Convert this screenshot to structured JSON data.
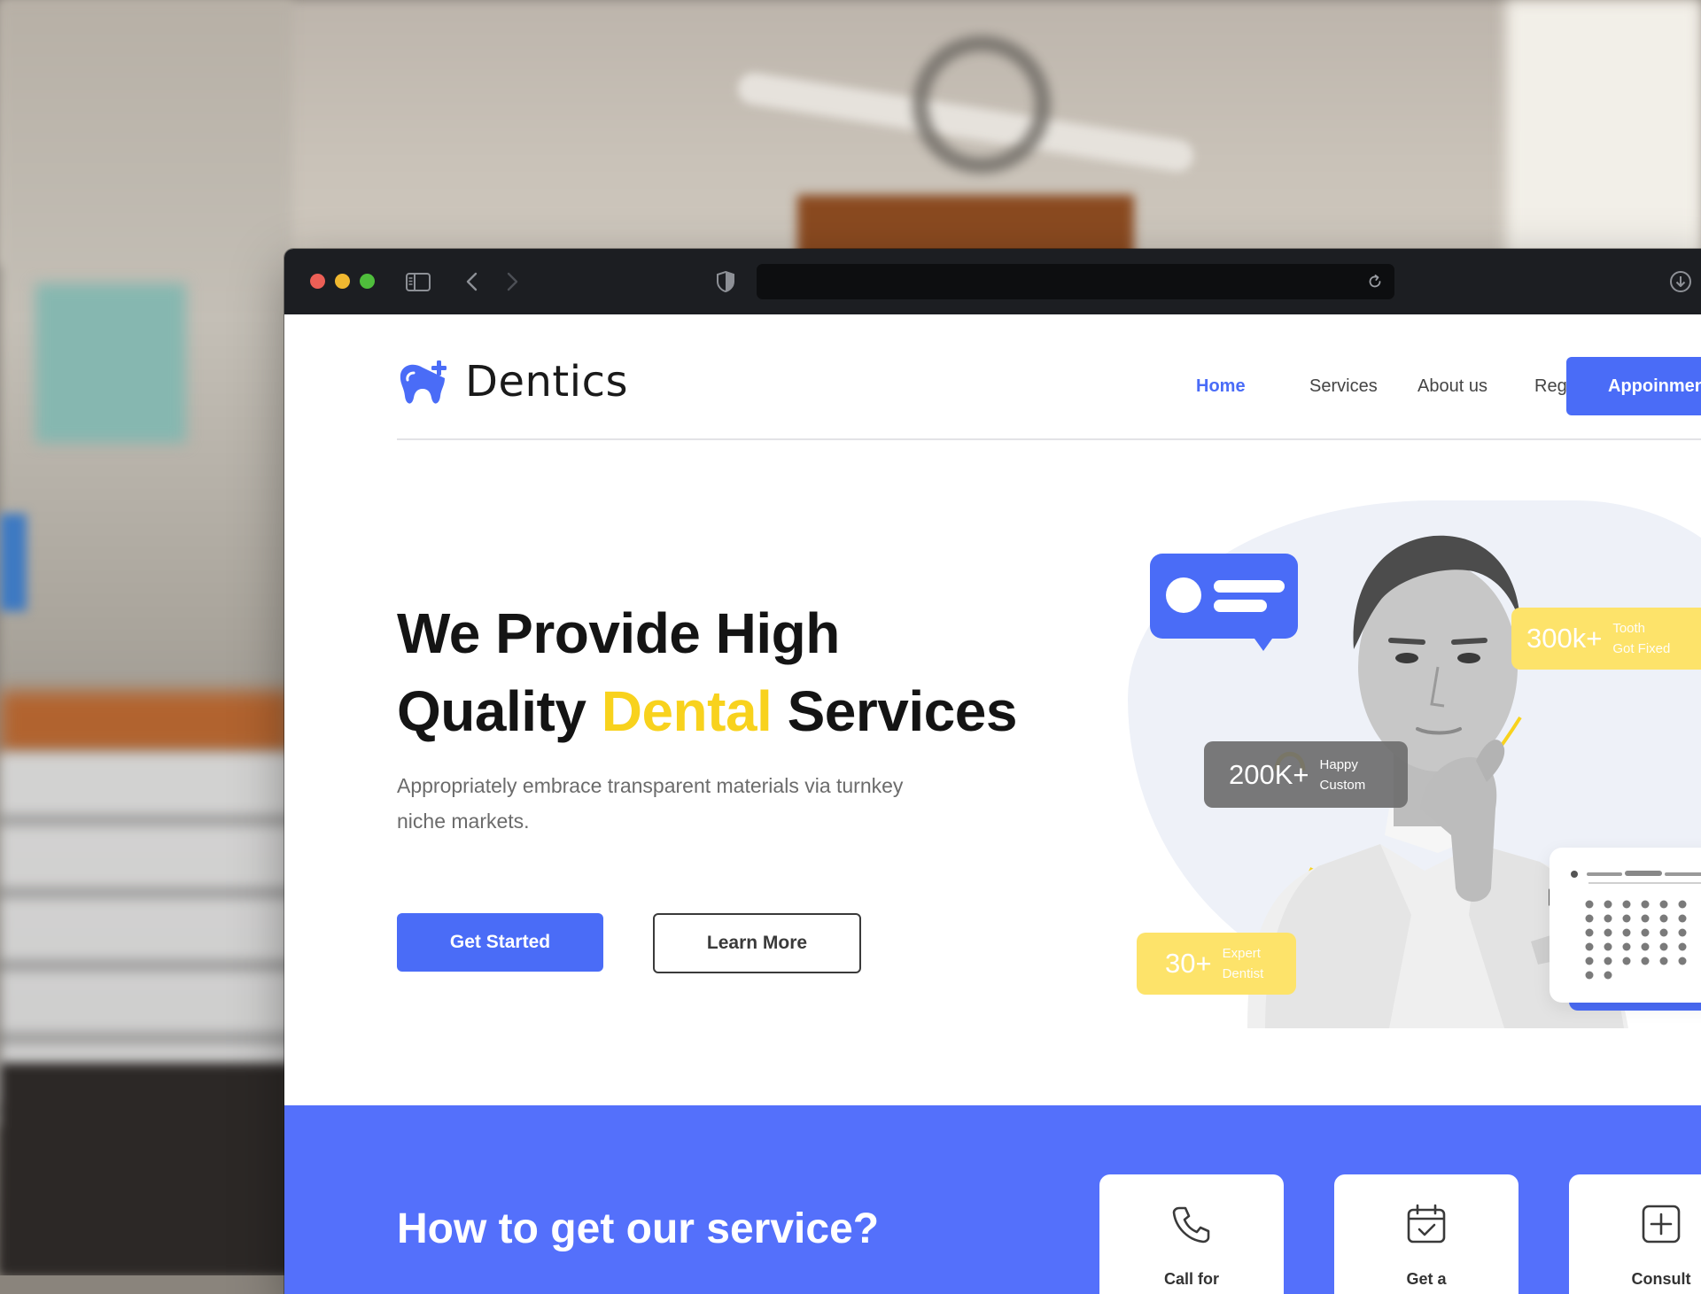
{
  "brand": {
    "name": "Dentics",
    "primary_color": "#4a6cf7",
    "accent_color": "#f8d21d"
  },
  "browser": {
    "nav_buttons": [
      "sidebar-icon",
      "back-icon",
      "forward-icon"
    ],
    "address": "",
    "icons": [
      "shield-icon",
      "reload-icon",
      "download-icon"
    ]
  },
  "nav": {
    "links": [
      {
        "label": "Home",
        "active": true
      },
      {
        "label": "Services",
        "active": false
      },
      {
        "label": "About us",
        "active": false
      },
      {
        "label": "Register",
        "active": false
      }
    ],
    "cta_label": "Appoinmen"
  },
  "hero": {
    "title_line1": "We Provide High",
    "title_line2_pre": "Quality ",
    "title_line2_accent": "Dental",
    "title_line2_post": " Services",
    "subtitle": "Appropriately embrace transparent materials via turnkey niche markets.",
    "primary_button": "Get Started",
    "secondary_button": "Learn More"
  },
  "stats": [
    {
      "value": "300k+",
      "label_line1": "Tooth",
      "label_line2": "Got Fixed"
    },
    {
      "value": "200K+",
      "label_line1": "Happy",
      "label_line2": "Custom"
    },
    {
      "value": "30+",
      "label_line1": "Expert",
      "label_line2": "Dentist"
    }
  ],
  "service_section": {
    "title": "How to get our service?",
    "cards": [
      {
        "icon": "phone-icon",
        "label": "Call for"
      },
      {
        "icon": "calendar-check-icon",
        "label": "Get a"
      },
      {
        "icon": "plus-square-icon",
        "label": "Consult"
      }
    ]
  }
}
